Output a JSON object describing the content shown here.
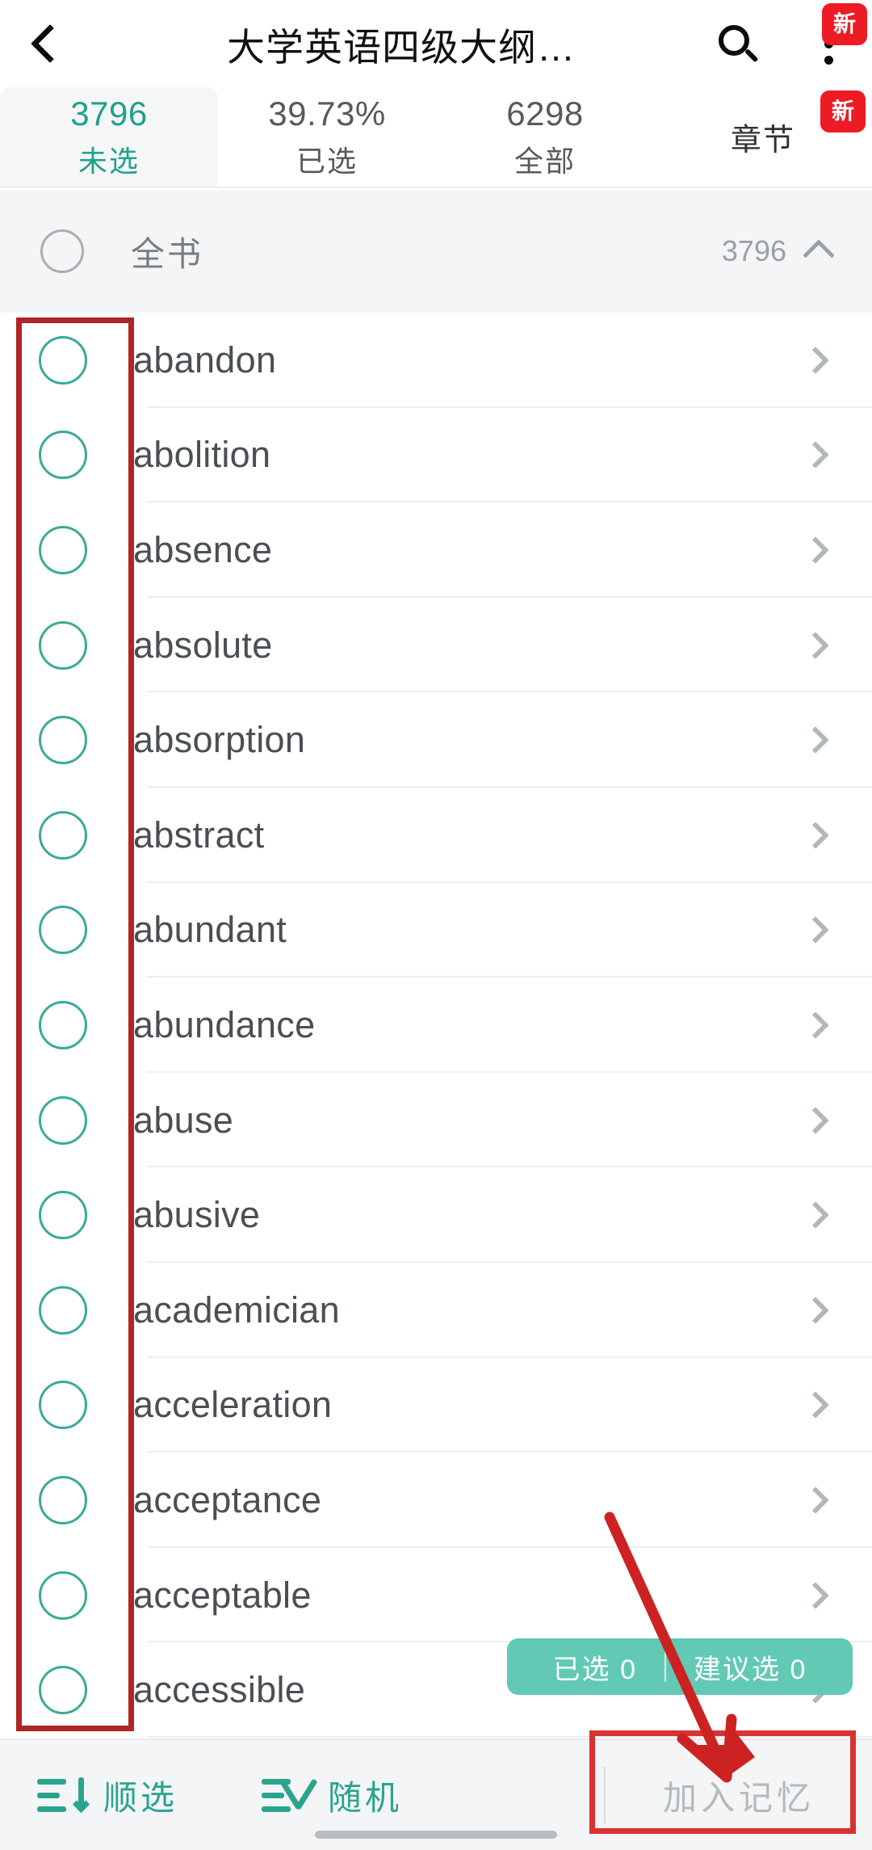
{
  "header": {
    "back_icon": "back-chevron-icon",
    "title": "大学英语四级大纲…",
    "search_icon": "search-icon",
    "menu_icon": "overflow-menu-icon",
    "badge_new": "新"
  },
  "tabs": [
    {
      "value": "3796",
      "label": "未选",
      "active": true
    },
    {
      "value": "39.73%",
      "label": "已选",
      "active": false
    },
    {
      "value": "6298",
      "label": "全部",
      "active": false
    },
    {
      "value": "",
      "label": "章节",
      "active": false,
      "badge": "新"
    }
  ],
  "group_header": {
    "checkbox_icon": "unchecked-circle-icon",
    "title": "全书",
    "count": "3796",
    "collapse_icon": "caret-up-icon"
  },
  "word_list": {
    "checkbox_icon": "unchecked-circle-icon",
    "chevron_icon": "chevron-right-icon",
    "words": [
      "abandon",
      "abolition",
      "absence",
      "absolute",
      "absorption",
      "abstract",
      "abundant",
      "abundance",
      "abuse",
      "abusive",
      "academician",
      "acceleration",
      "acceptance",
      "acceptable",
      "accessible"
    ]
  },
  "selection_pill": {
    "selected_text": "已选 0",
    "suggested_text": "建议选 0"
  },
  "bottom_bar": {
    "sequential_icon": "sort-descending-icon",
    "sequential_label": "顺选",
    "random_icon": "shuffle-icon",
    "random_label": "随机",
    "memory_label": "加入记忆"
  },
  "annotations": {
    "checkbox_column_box": "highlight-box",
    "memory_button_box": "highlight-box",
    "arrow": "pointer-arrow"
  },
  "colors": {
    "accent_teal": "#2aa48f",
    "pill_green": "#62c9b5",
    "badge_red": "#ed1b23",
    "annotation_red": "#b02525",
    "checkbox_teal": "#3aab96",
    "text_primary": "#4a4f54",
    "text_muted": "#9aa0a5",
    "bar_background": "#f4f5f6"
  }
}
